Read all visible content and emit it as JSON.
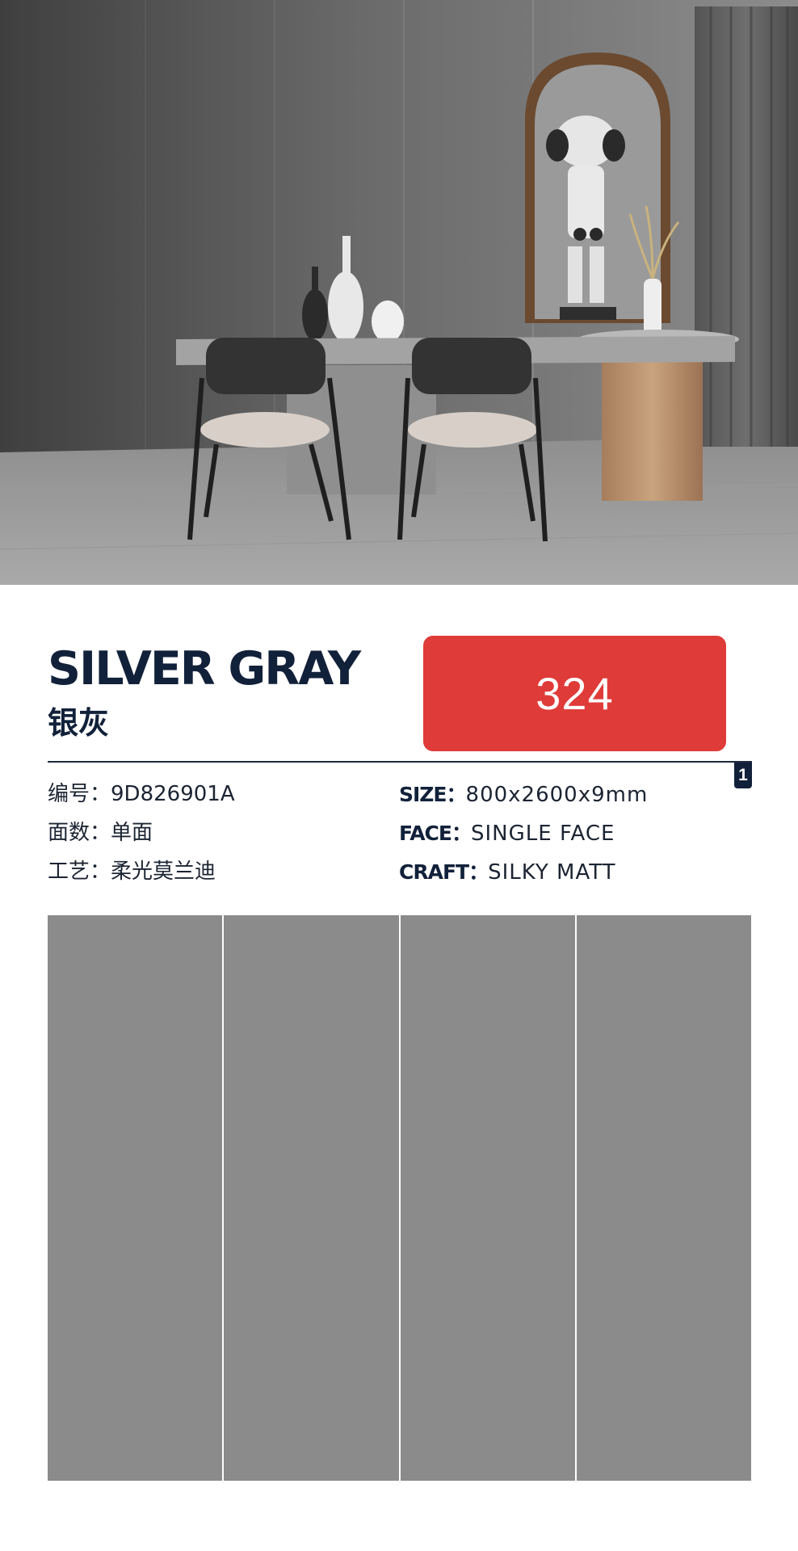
{
  "product": {
    "name_en": "SILVER GRAY",
    "name_cn": "银灰",
    "price": "324",
    "page_badge": "1"
  },
  "specs_cn": [
    {
      "label": "编号：",
      "value": "9D826901A"
    },
    {
      "label": "面数：",
      "value": "单面"
    },
    {
      "label": "工艺：",
      "value": "柔光莫兰迪"
    }
  ],
  "specs_en": [
    {
      "label": "SIZE",
      "sep": "：",
      "value": "800x2600x9mm"
    },
    {
      "label": "FACE",
      "sep": "：",
      "value": "SINGLE FACE"
    },
    {
      "label": "CRAFT",
      "sep": "：",
      "value": "SILKY MATT"
    }
  ],
  "colors": {
    "accent_red": "#df3b39",
    "navy": "#12213a",
    "tile_gray": "#8b8b8b"
  },
  "swatch": {
    "panel_count": 4
  }
}
